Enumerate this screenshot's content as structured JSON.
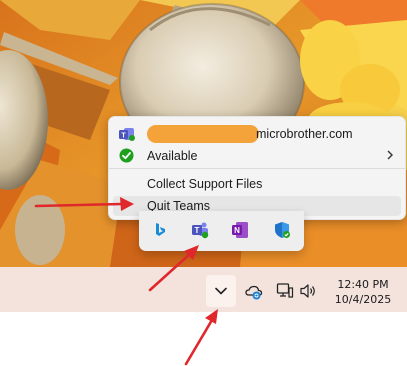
{
  "context_menu": {
    "email_suffix": "microbrother.com",
    "status_label": "Available",
    "collect_label": "Collect Support Files",
    "quit_label": "Quit Teams",
    "redaction_color": "#f4a33a",
    "status_color": "#1ea01e"
  },
  "overflow_tray": {
    "icons": [
      "bing-icon",
      "teams-icon",
      "onenote-icon",
      "security-shield-icon"
    ]
  },
  "taskbar": {
    "time": "12:40 PM",
    "date": "10/4/2025",
    "background": "#f3e3dc"
  },
  "annotation": {
    "arrow_color": "#e0272b"
  }
}
